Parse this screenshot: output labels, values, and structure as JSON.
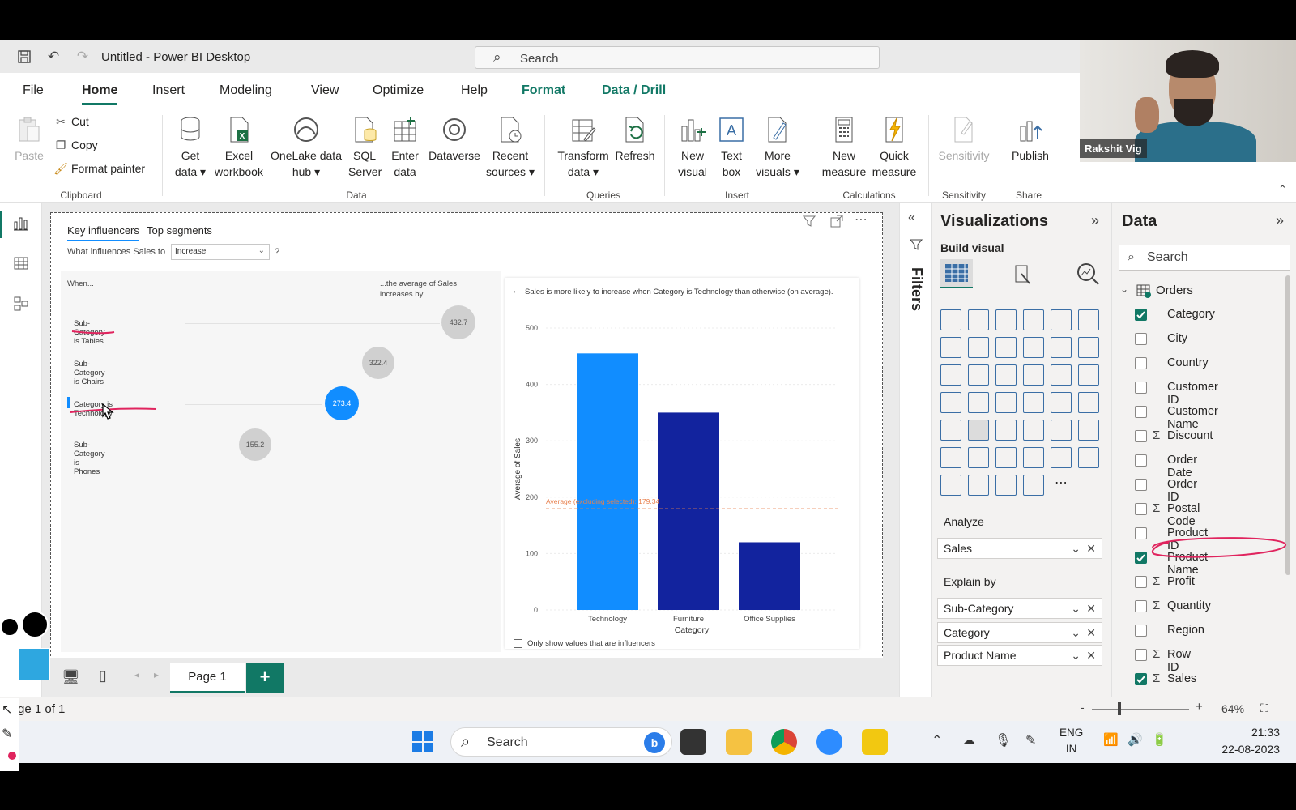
{
  "titlebar": {
    "title": "Untitled - Power BI Desktop",
    "search_placeholder": "Search"
  },
  "menu": {
    "file": "File",
    "home": "Home",
    "insert": "Insert",
    "modeling": "Modeling",
    "view": "View",
    "optimize": "Optimize",
    "help": "Help",
    "format": "Format",
    "data_drill": "Data / Drill"
  },
  "ribbon": {
    "clipboard": {
      "paste": "Paste",
      "cut": "Cut",
      "copy": "Copy",
      "format_painter": "Format painter",
      "label": "Clipboard"
    },
    "data": {
      "get_data": [
        "Get",
        "data ▾"
      ],
      "excel": [
        "Excel",
        "workbook"
      ],
      "onelake": [
        "OneLake data",
        "hub ▾"
      ],
      "sql": [
        "SQL",
        "Server"
      ],
      "enter": [
        "Enter",
        "data"
      ],
      "dataverse": "Dataverse",
      "recent": [
        "Recent",
        "sources ▾"
      ],
      "label": "Data"
    },
    "queries": {
      "transform": [
        "Transform",
        "data ▾"
      ],
      "refresh": "Refresh",
      "label": "Queries"
    },
    "insert": {
      "new_visual": [
        "New",
        "visual"
      ],
      "text_box": [
        "Text",
        "box"
      ],
      "more_visuals": [
        "More",
        "visuals ▾"
      ],
      "label": "Insert"
    },
    "calculations": {
      "new_measure": [
        "New",
        "measure"
      ],
      "quick_measure": [
        "Quick",
        "measure"
      ],
      "label": "Calculations"
    },
    "sensitivity": {
      "btn": "Sensitivity",
      "label": "Sensitivity"
    },
    "share": {
      "publish": "Publish",
      "label": "Share"
    }
  },
  "webcam": {
    "name": "Rakshit Vig"
  },
  "visual": {
    "tabs": [
      "Key influencers",
      "Top segments"
    ],
    "question": "What influences Sales to",
    "select_value": "Increase",
    "help": "?",
    "when_header": "When...",
    "avg_header": [
      "...the average of Sales",
      "increases by"
    ],
    "influencers": [
      {
        "label": "Sub-Category is Tables",
        "value": "432.7"
      },
      {
        "label": "Sub-Category is Chairs",
        "value": "322.4"
      },
      {
        "label": "Category is Technology",
        "value": "273.4"
      },
      {
        "label": "Sub-Category is Phones",
        "value": "155.2"
      }
    ],
    "detail_title": "Sales is more likely to increase when Category is Technology than otherwise (on average).",
    "only_show": "Only show values that are influencers"
  },
  "chart_data": {
    "type": "bar",
    "categories": [
      "Technology",
      "Furniture",
      "Office Supplies"
    ],
    "values": [
      455,
      350,
      120
    ],
    "xlabel": "Category",
    "ylabel": "Average of Sales",
    "ylim": [
      0,
      500
    ],
    "yticks": [
      0,
      100,
      200,
      300,
      400,
      500
    ],
    "reference_line": {
      "label": "Average (excluding selected): 179.34",
      "value": 179.34,
      "color": "#e8804e"
    },
    "colors": {
      "selected": "#118dff",
      "other": "#12239e"
    }
  },
  "pages": {
    "page1": "Page 1",
    "add": "+"
  },
  "filters": {
    "label": "Filters"
  },
  "viz": {
    "title": "Visualizations",
    "build_visual": "Build visual",
    "analyze_label": "Analyze",
    "analyze_field": "Sales",
    "explain_label": "Explain by",
    "explain_fields": [
      "Sub-Category",
      "Category",
      "Product Name"
    ]
  },
  "data_pane": {
    "title": "Data",
    "search_placeholder": "Search",
    "table": "Orders",
    "fields": [
      {
        "name": "Category",
        "checked": true,
        "sigma": false
      },
      {
        "name": "City",
        "checked": false,
        "sigma": false
      },
      {
        "name": "Country",
        "checked": false,
        "sigma": false
      },
      {
        "name": "Customer ID",
        "checked": false,
        "sigma": false
      },
      {
        "name": "Customer Name",
        "checked": false,
        "sigma": false
      },
      {
        "name": "Discount",
        "checked": false,
        "sigma": true
      },
      {
        "name": "Order Date",
        "checked": false,
        "sigma": false
      },
      {
        "name": "Order ID",
        "checked": false,
        "sigma": false
      },
      {
        "name": "Postal Code",
        "checked": false,
        "sigma": true
      },
      {
        "name": "Product ID",
        "checked": false,
        "sigma": false
      },
      {
        "name": "Product Name",
        "checked": true,
        "sigma": false
      },
      {
        "name": "Profit",
        "checked": false,
        "sigma": true
      },
      {
        "name": "Quantity",
        "checked": false,
        "sigma": true
      },
      {
        "name": "Region",
        "checked": false,
        "sigma": false
      },
      {
        "name": "Row ID",
        "checked": false,
        "sigma": true
      },
      {
        "name": "Sales",
        "checked": true,
        "sigma": true
      }
    ]
  },
  "status": {
    "page_of": "ge 1 of 1",
    "zoom": "64%"
  },
  "taskbar": {
    "search": "Search",
    "lang": [
      "ENG",
      "IN"
    ],
    "time": "21:33",
    "date": "22-08-2023"
  }
}
